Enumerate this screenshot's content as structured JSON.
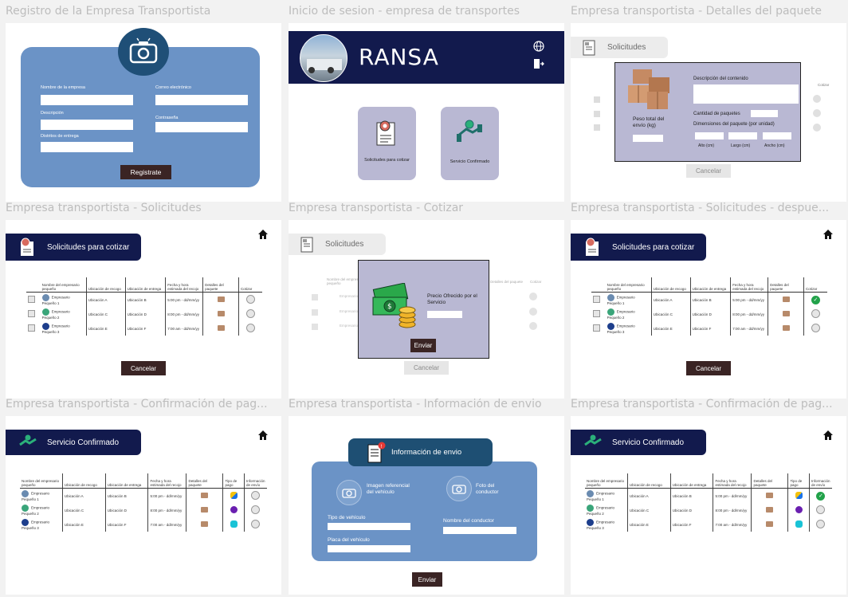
{
  "frame_labels": [
    "Registro de la Empresa Transportista",
    "Inicio de sesion - empresa de transportes",
    "Empresa transportista - Detalles del paquete",
    "Empresa transportista - Solicitudes",
    "Empresa transportista - Cotizar",
    "Empresa transportista - Solicitudes - despue...",
    "Empresa transportista - Confirmación de pag...",
    "Empresa transportista - Información de envio",
    "Empresa transportista - Confirmación de pag..."
  ],
  "registro": {
    "nombre_label": "Nombre de la empresa",
    "correo_label": "Correo electrónico",
    "descripcion_label": "Descripción",
    "contrasena_label": "Contraseña",
    "distritos_label": "Distritos de entrega",
    "register_button": "Registrate"
  },
  "login": {
    "brand": "RANSA",
    "card_cotizar": "Solicitudes para cotizar",
    "card_confirmado": "Servicio Confirmado"
  },
  "detalles": {
    "tab": "Solicitudes",
    "descripcion_label": "Descripción del contenido",
    "cantidad_label": "Cantidad de paquetes",
    "dimensiones_label": "Dimensiones del paquete (por unidad)",
    "peso_label": "Peso total del envío (kg)",
    "alto": "Alto (cm)",
    "largo": "Largo (cm)",
    "ancho": "Ancho (cm)",
    "cancel": "Cancelar",
    "bg_cotizar": "Cotizar"
  },
  "solicitudes_tab": "Solicitudes para cotizar",
  "confirmado_tab": "Servicio Confirmado",
  "cancelar": "Cancelar",
  "table_headers": [
    "Nombre del empresario pequeño",
    "Ubicación de recogo",
    "Ubicación de entrega",
    "Fecha y hora estimada del recojo",
    "Detalles del paquete",
    "Cotizar"
  ],
  "conf_headers": [
    "Nombre del empresario pequeño",
    "Ubicación de recogo",
    "Ubicación de entrega",
    "Fecha y hora estimada del recojo",
    "Detalles del paquete",
    "Tipo de pago",
    "Información de envío"
  ],
  "rows": [
    {
      "name": "Empresario Pequeño 1",
      "recogo": "Ubicación A",
      "entrega": "Ubicación B",
      "fecha": "5:00 pm - dd/mm/yy",
      "logo": "#6a8bb0"
    },
    {
      "name": "Empresario Pequeño 2",
      "recogo": "Ubicación C",
      "entrega": "Ubicación D",
      "fecha": "8:00 pm - dd/mm/yy",
      "logo": "#3aa57a"
    },
    {
      "name": "Empresario Pequeño 3",
      "recogo": "Ubicación E",
      "entrega": "Ubicación F",
      "fecha": "7:00 am - dd/mm/yy",
      "logo": "#1d3e8c"
    }
  ],
  "cotizar": {
    "tab": "Solicitudes",
    "price_label": "Precio Ofrecido por el Servicio",
    "send": "Enviar",
    "cancel": "Cancelar",
    "bg_header": "Nombre del empresario pequeño",
    "bg_detalles": "Detalles del paquete",
    "bg_cotizar": "Cotizar",
    "bg_rows": [
      "Empresario Pequeño 1",
      "Empresario Pequeño 2",
      "Empresario Pequeño 3"
    ]
  },
  "info_envio": {
    "title": "Información de envio",
    "imagen_label": "Imagen referencial del vehículo",
    "foto_label": "Foto del conductor",
    "tipo_label": "Tipo de vehículo",
    "nombre_conductor_label": "Nombre del conductor",
    "placa_label": "Placa del vehículo",
    "send": "Enviar"
  },
  "colors": {
    "form_blue": "#6b93c6",
    "navy": "#121a4d",
    "dark_button": "#3a2424",
    "modal_lavender": "#b9b8d3",
    "ok_green": "#22a24a"
  },
  "icons": [
    "camera-icon",
    "globe-icon",
    "logout-icon",
    "document-icon",
    "handshake-icon",
    "home-icon",
    "money-icon",
    "boxes-icon"
  ]
}
